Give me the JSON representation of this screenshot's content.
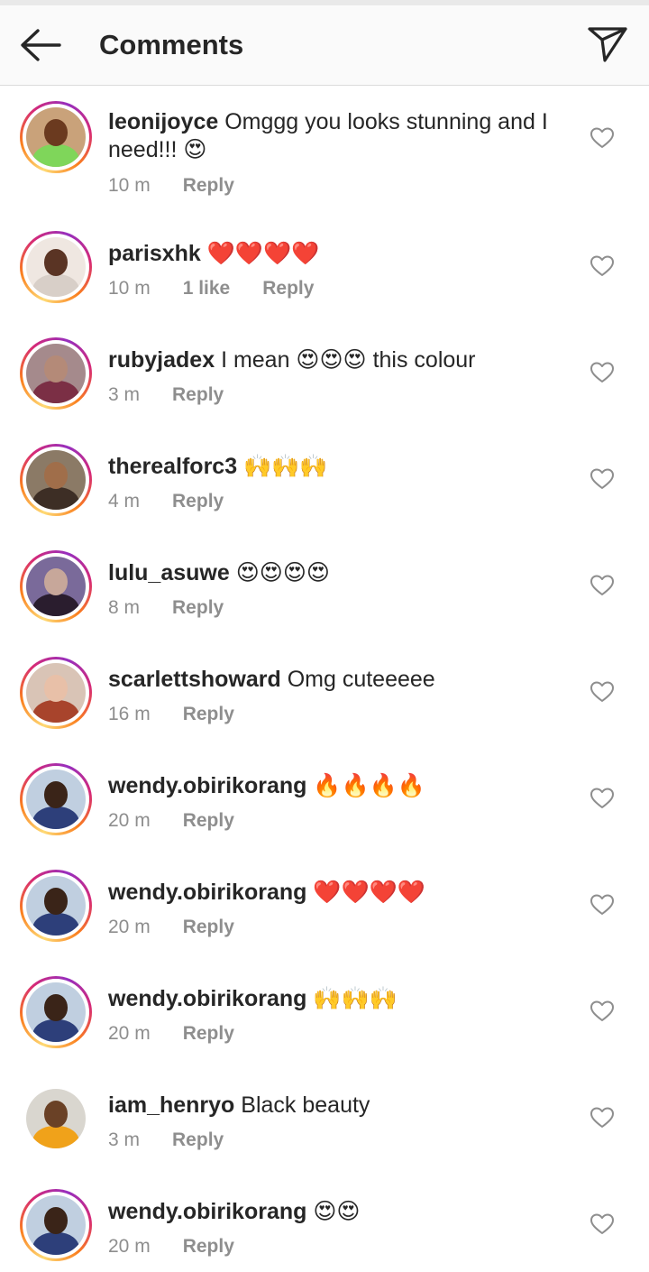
{
  "header": {
    "title": "Comments",
    "back_icon": "arrow-left-icon",
    "send_icon": "paper-plane-icon"
  },
  "comments": [
    {
      "username": "leonijoyce",
      "text": "Omggg you looks stunning and I need!!! 😍",
      "time": "10 m",
      "likes": "",
      "reply": "Reply",
      "ring": true,
      "skin": "#6b3a1f",
      "shirt": "#7fd65a",
      "bg": "#c9a27a"
    },
    {
      "username": "parisxhk",
      "text": "❤️❤️❤️❤️",
      "time": "10 m",
      "likes": "1 like",
      "reply": "Reply",
      "ring": true,
      "skin": "#5a3424",
      "shirt": "#d8cfc8",
      "bg": "#efe7e1"
    },
    {
      "username": "rubyjadex",
      "text": "I mean 😍😍😍 this colour",
      "time": "3 m",
      "likes": "",
      "reply": "Reply",
      "ring": true,
      "skin": "#b48a78",
      "shirt": "#7b2f45",
      "bg": "#a58a8c"
    },
    {
      "username": "therealforc3",
      "text": "🙌🙌🙌",
      "time": "4 m",
      "likes": "",
      "reply": "Reply",
      "ring": true,
      "skin": "#a06e4a",
      "shirt": "#3d2e25",
      "bg": "#8b7a66"
    },
    {
      "username": "lulu_asuwe",
      "text": "😍😍😍😍",
      "time": "8 m",
      "likes": "",
      "reply": "Reply",
      "ring": true,
      "skin": "#c7a79a",
      "shirt": "#2a1d2e",
      "bg": "#7a6a9a"
    },
    {
      "username": "scarlettshoward",
      "text": "Omg cuteeeee",
      "time": "16 m",
      "likes": "",
      "reply": "Reply",
      "ring": true,
      "skin": "#e8c0a8",
      "shirt": "#a8442c",
      "bg": "#d9c4b6"
    },
    {
      "username": "wendy.obirikorang",
      "text": "🔥🔥🔥🔥",
      "time": "20 m",
      "likes": "",
      "reply": "Reply",
      "ring": true,
      "skin": "#3a2418",
      "shirt": "#2d3f7a",
      "bg": "#c0cfe0"
    },
    {
      "username": "wendy.obirikorang",
      "text": "❤️❤️❤️❤️",
      "time": "20 m",
      "likes": "",
      "reply": "Reply",
      "ring": true,
      "skin": "#3a2418",
      "shirt": "#2d3f7a",
      "bg": "#c0cfe0"
    },
    {
      "username": "wendy.obirikorang",
      "text": "🙌🙌🙌",
      "time": "20 m",
      "likes": "",
      "reply": "Reply",
      "ring": true,
      "skin": "#3a2418",
      "shirt": "#2d3f7a",
      "bg": "#c0cfe0"
    },
    {
      "username": "iam_henryo",
      "text": "Black beauty",
      "time": "3 m",
      "likes": "",
      "reply": "Reply",
      "ring": false,
      "skin": "#6a4126",
      "shirt": "#f0a21a",
      "bg": "#d9d6cf"
    },
    {
      "username": "wendy.obirikorang",
      "text": "😍😍",
      "time": "20 m",
      "likes": "",
      "reply": "Reply",
      "ring": true,
      "skin": "#3a2418",
      "shirt": "#2d3f7a",
      "bg": "#c0cfe0"
    }
  ]
}
